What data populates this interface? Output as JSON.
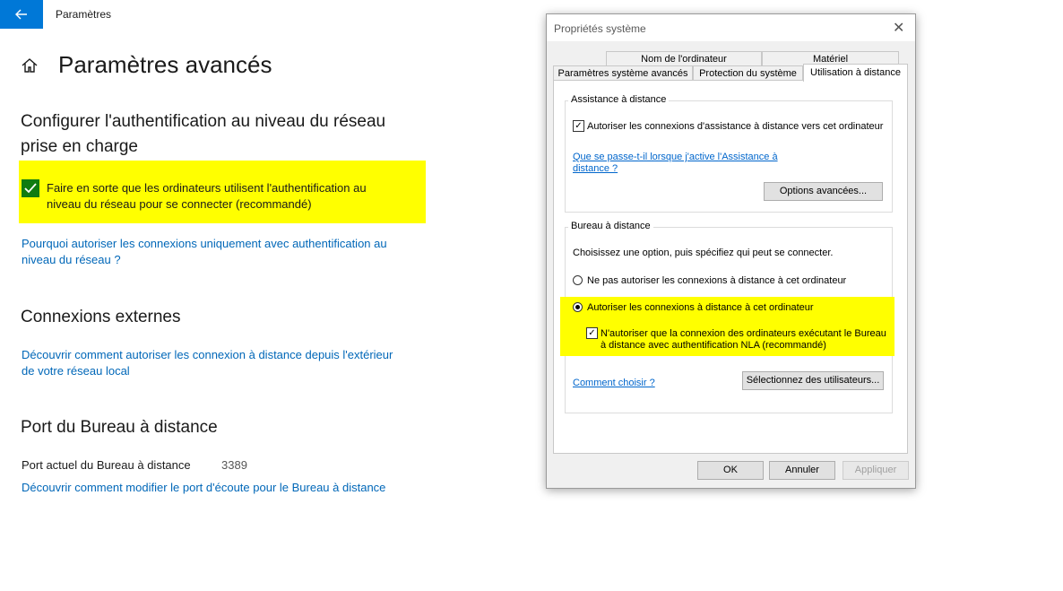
{
  "colors": {
    "accent": "#0078d7",
    "highlight": "#ffff00",
    "check_green": "#107c10",
    "link": "#0067b8"
  },
  "settings": {
    "back_icon": "arrow-left-icon",
    "app_title": "Paramètres",
    "home_icon": "home-icon",
    "page_title": "Paramètres avancés",
    "nla_section": {
      "heading_line1": "Configurer l'authentification au niveau du réseau",
      "heading_line2": "prise en charge",
      "checkbox_line1": "Faire en sorte que les ordinateurs utilisent l'authentification au",
      "checkbox_line2": "niveau du réseau pour se connecter (recommandé)",
      "checked": true,
      "link_line1": "Pourquoi autoriser les connexions uniquement avec authentification au",
      "link_line2": "niveau du réseau ?"
    },
    "external": {
      "heading": "Connexions externes",
      "link_line1": "Découvrir comment autoriser les connexion à distance depuis l'extérieur",
      "link_line2": "de votre réseau local"
    },
    "port": {
      "heading": "Port du Bureau à distance",
      "label": "Port actuel du Bureau à distance",
      "value": "3389",
      "link": "Découvrir comment modifier le port d'écoute pour le Bureau à distance"
    }
  },
  "dialog": {
    "title": "Propriétés système",
    "close_icon": "close-icon",
    "tabs_row1": [
      "Nom de l'ordinateur",
      "Matériel"
    ],
    "tabs_row2": [
      "Paramètres système avancés",
      "Protection du système",
      "Utilisation à distance"
    ],
    "active_tab": "Utilisation à distance",
    "assistance": {
      "group_title": "Assistance à distance",
      "checkbox_label": "Autoriser les connexions d'assistance à distance vers cet ordinateur",
      "checked": true,
      "link_line1": "Que se passe-t-il lorsque j'active l'Assistance à",
      "link_line2": "distance ?",
      "advanced_button": "Options avancées..."
    },
    "remote_desktop": {
      "group_title": "Bureau à distance",
      "instruction": "Choisissez une option, puis spécifiez qui peut se connecter.",
      "radio_no": "Ne pas autoriser les connexions à distance à cet ordinateur",
      "radio_yes": "Autoriser les connexions à distance à cet ordinateur",
      "selected": "radio_yes",
      "nla_line1": "N'autoriser que la connexion des ordinateurs exécutant le Bureau",
      "nla_line2": "à distance avec authentification NLA (recommandé)",
      "nla_checked": true,
      "help_link": "Comment choisir ?",
      "select_users_button": "Sélectionnez des utilisateurs..."
    },
    "buttons": {
      "ok": "OK",
      "cancel": "Annuler",
      "apply": "Appliquer"
    }
  }
}
